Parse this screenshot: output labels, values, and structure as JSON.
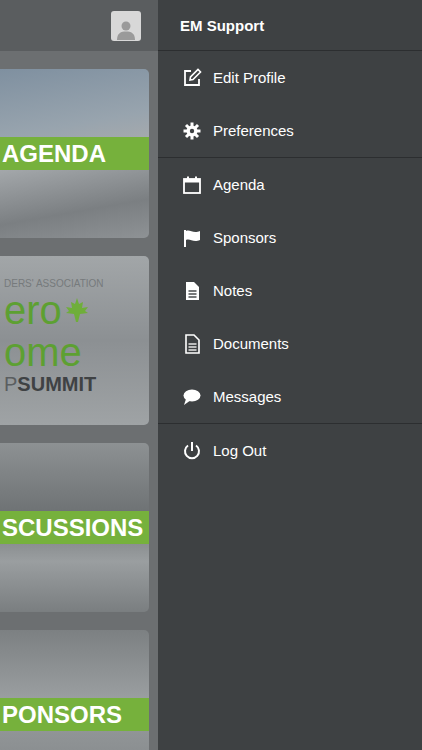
{
  "tiles": [
    {
      "kind": "label",
      "label": "AGENDA"
    },
    {
      "kind": "logo",
      "logo": {
        "top": "DERS' ASSOCIATION",
        "line1": "ero",
        "line2": "ome",
        "prefix": "P",
        "suffix": "SUMMIT"
      }
    },
    {
      "kind": "label",
      "label": "SCUSSIONS"
    },
    {
      "kind": "label",
      "label": "PONSORS"
    }
  ],
  "drawer": {
    "title": "EM Support",
    "groups": [
      [
        {
          "label": "Edit Profile"
        },
        {
          "label": "Preferences"
        }
      ],
      [
        {
          "label": "Agenda"
        },
        {
          "label": "Sponsors"
        },
        {
          "label": "Notes"
        },
        {
          "label": "Documents"
        },
        {
          "label": "Messages"
        }
      ],
      [
        {
          "label": "Log Out"
        }
      ]
    ]
  }
}
